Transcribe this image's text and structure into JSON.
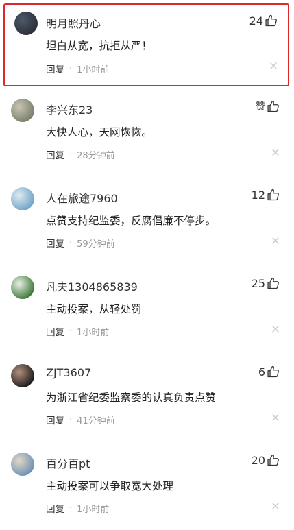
{
  "comments": [
    {
      "username": "明月照丹心",
      "likes": "24",
      "content": "坦白从宽，抗拒从严！",
      "reply_label": "回复",
      "time": "1小时前",
      "highlighted": true,
      "avatar_colors": [
        "#2d2f38",
        "#4a5a6a"
      ]
    },
    {
      "username": "李兴东23",
      "likes": "赞",
      "content": "大快人心，天网恢恢。",
      "reply_label": "回复",
      "time": "28分钟前",
      "highlighted": false,
      "avatar_colors": [
        "#7a7f6c",
        "#c9c4b2"
      ]
    },
    {
      "username": "人在旅途7960",
      "likes": "12",
      "content": "点赞支持纪监委，反腐倡廉不停步。",
      "reply_label": "回复",
      "time": "59分钟前",
      "highlighted": false,
      "avatar_colors": [
        "#6fa6c8",
        "#dfe9ef"
      ]
    },
    {
      "username": "凡夫1304865839",
      "likes": "25",
      "content": "主动投案，从轻处罚",
      "reply_label": "回复",
      "time": "1小时前",
      "highlighted": false,
      "avatar_colors": [
        "#3c7a3a",
        "#e9efe4"
      ]
    },
    {
      "username": "ZJT3607",
      "likes": "6",
      "content": "为浙江省纪委监察委的认真负责点赞",
      "reply_label": "回复",
      "time": "41分钟前",
      "highlighted": false,
      "avatar_colors": [
        "#1c1c1c",
        "#b38f7c"
      ]
    },
    {
      "username": "百分百pt",
      "likes": "20",
      "content": "主动投案可以争取宽大处理",
      "reply_label": "回复",
      "time": "1小时前",
      "highlighted": false,
      "avatar_colors": [
        "#6f92b4",
        "#e2d6c6"
      ]
    }
  ]
}
